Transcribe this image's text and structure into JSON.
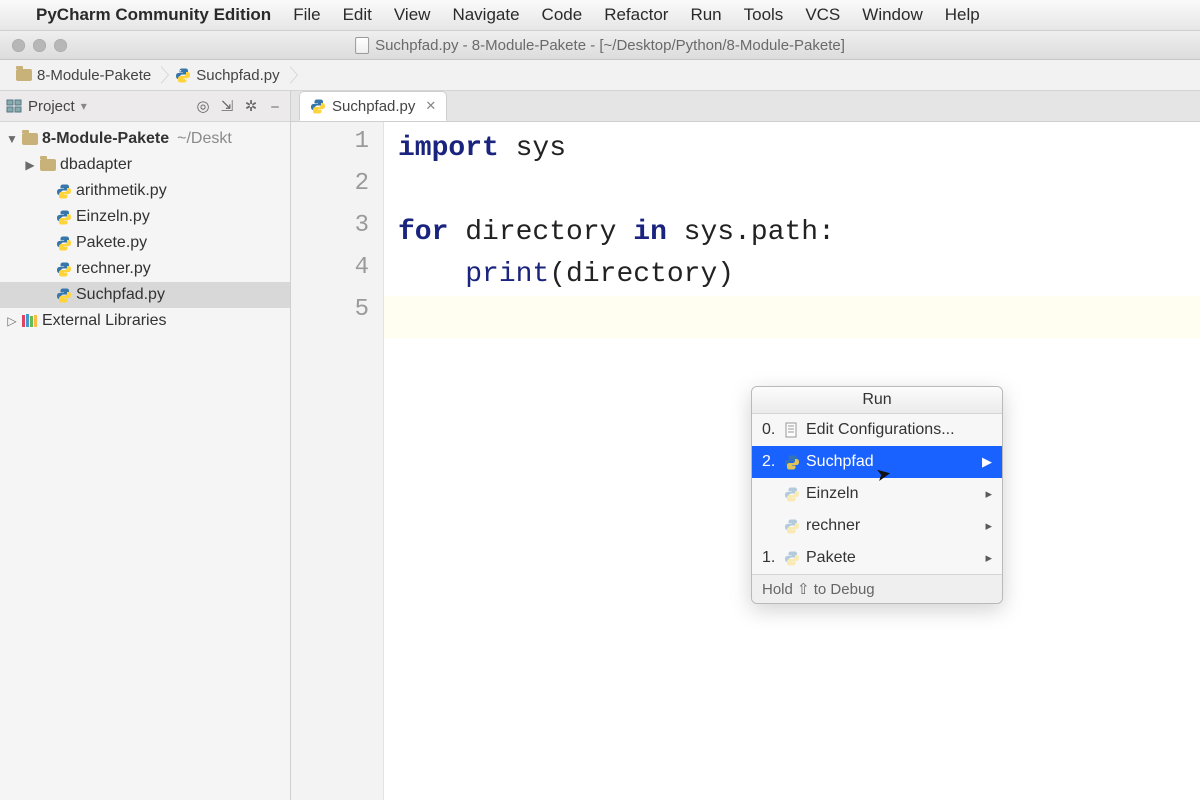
{
  "mac_menu": {
    "apple_icon": "",
    "app_name": "PyCharm Community Edition",
    "items": [
      "File",
      "Edit",
      "View",
      "Navigate",
      "Code",
      "Refactor",
      "Run",
      "Tools",
      "VCS",
      "Window",
      "Help"
    ]
  },
  "window_title": "Suchpfad.py - 8-Module-Pakete - [~/Desktop/Python/8-Module-Pakete]",
  "breadcrumbs": {
    "root": "8-Module-Pakete",
    "file": "Suchpfad.py"
  },
  "project_tool": {
    "title": "Project",
    "root": {
      "name": "8-Module-Pakete",
      "path_hint": "~/Deskt"
    },
    "folders": [
      "dbadapter"
    ],
    "files": [
      "arithmetik.py",
      "Einzeln.py",
      "Pakete.py",
      "rechner.py",
      "Suchpfad.py"
    ],
    "selected_file": "Suchpfad.py",
    "external_libs": "External Libraries"
  },
  "editor": {
    "tab": {
      "label": "Suchpfad.py"
    },
    "line_numbers": [
      "1",
      "2",
      "3",
      "4",
      "5"
    ],
    "lines": {
      "l1a": "import",
      "l1b": " sys",
      "l3a": "for",
      "l3b": " directory ",
      "l3c": "in",
      "l3d": " sys.path:",
      "l4a": "    ",
      "l4b": "print",
      "l4c": "(directory)"
    }
  },
  "run_popup": {
    "title": "Run",
    "items": [
      {
        "num": "0.",
        "label": "Edit Configurations...",
        "icon": "config",
        "arrow": false
      },
      {
        "num": "2.",
        "label": "Suchpfad",
        "icon": "py",
        "arrow": true,
        "selected": true
      },
      {
        "num": "",
        "label": "Einzeln",
        "icon": "py-dim",
        "arrow": true
      },
      {
        "num": "",
        "label": "rechner",
        "icon": "py-dim",
        "arrow": true
      },
      {
        "num": "1.",
        "label": "Pakete",
        "icon": "py-dim",
        "arrow": true
      }
    ],
    "hint": "Hold ⇧ to Debug"
  }
}
